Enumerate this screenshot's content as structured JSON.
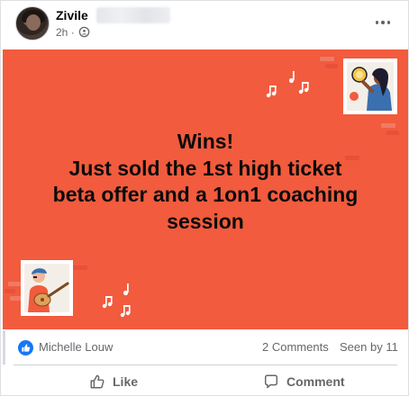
{
  "post": {
    "author_name": "Zivile",
    "time": "2h",
    "time_separator": "·",
    "audience_icon": "group-privacy-icon",
    "more_icon": "more-horizontal-icon"
  },
  "banner": {
    "lines": [
      "Wins!",
      "Just sold the 1st high ticket",
      "beta offer and a 1on1 coaching",
      "session"
    ],
    "background_color": "#f25b3d",
    "illustrations": [
      "tambourine-person-illustration",
      "guitar-player-illustration"
    ],
    "note_icons": [
      "music-notes-icon",
      "music-notes-icon"
    ]
  },
  "stats": {
    "reaction_icon": "like-reaction-icon",
    "reactors": "Michelle Louw",
    "comments": "2 Comments",
    "seen_by": "Seen by 11"
  },
  "actions": {
    "like_label": "Like",
    "like_icon": "thumbs-up-icon",
    "comment_label": "Comment",
    "comment_icon": "comment-bubble-icon"
  },
  "colors": {
    "accent": "#1877f2",
    "muted_text": "#65676b",
    "banner": "#f25b3d"
  }
}
